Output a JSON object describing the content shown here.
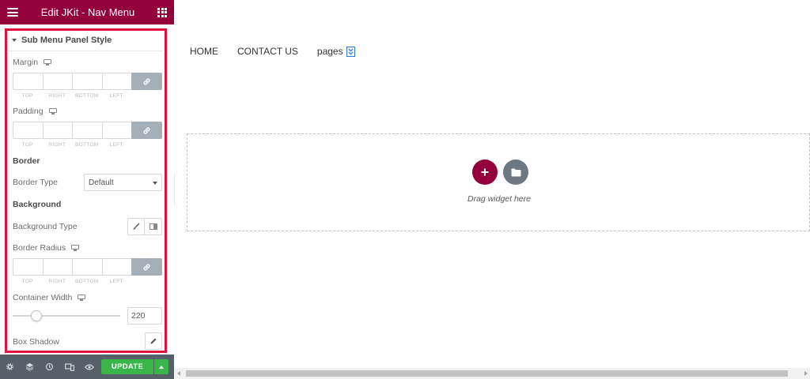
{
  "header": {
    "title": "Edit JKit - Nav Menu",
    "menu_icon": "hamburger-icon",
    "apps_icon": "grid-icon"
  },
  "section": {
    "title": "Sub Menu Panel Style"
  },
  "margin": {
    "label": "Margin",
    "sides": [
      "TOP",
      "RIGHT",
      "BOTTOM",
      "LEFT"
    ],
    "values": [
      "",
      "",
      "",
      ""
    ]
  },
  "padding": {
    "label": "Padding",
    "sides": [
      "TOP",
      "RIGHT",
      "BOTTOM",
      "LEFT"
    ],
    "values": [
      "",
      "",
      "",
      ""
    ]
  },
  "border": {
    "heading": "Border",
    "type_label": "Border Type",
    "type_value": "Default"
  },
  "background": {
    "heading": "Background",
    "type_label": "Background Type"
  },
  "border_radius": {
    "label": "Border Radius",
    "sides": [
      "TOP",
      "RIGHT",
      "BOTTOM",
      "LEFT"
    ],
    "values": [
      "",
      "",
      "",
      ""
    ]
  },
  "container_width": {
    "label": "Container Width",
    "value": "220",
    "slider_fraction": 0.22
  },
  "box_shadow": {
    "label": "Box Shadow"
  },
  "footer": {
    "update_label": "UPDATE",
    "icons": [
      "gear-icon",
      "layers-icon",
      "history-icon",
      "responsive-icon",
      "eye-icon"
    ]
  },
  "canvas": {
    "nav_items": [
      "HOME",
      "CONTACT US"
    ],
    "pages_label": "pages",
    "drop_text": "Drag widget here"
  },
  "colors": {
    "brand": "#93003c",
    "update": "#39b54a",
    "footer": "#556068",
    "highlight": "#e2133a"
  }
}
